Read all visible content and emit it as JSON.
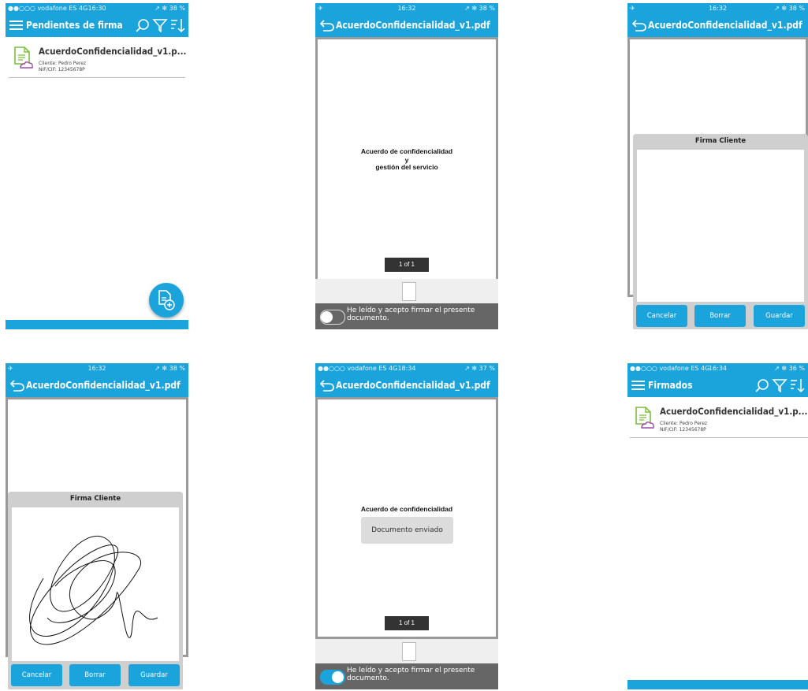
{
  "colors": {
    "accent": "#1ba4dc",
    "overlay": "#666666",
    "panel": "#cfcfcf"
  },
  "screens": [
    {
      "status": {
        "left": "●●○○○ vodafone ES  4G",
        "time": "16:30",
        "right": "↗ ✻ 38 %"
      },
      "title": "Pendientes de firma",
      "item": {
        "name": "AcuerdoConfidencialidad_v1.p...",
        "client": "Cliente: Pedro Perez",
        "nif": "NIF/CIF: 12345678P"
      },
      "icons": [
        "menu-icon",
        "search-icon",
        "filter-icon",
        "sort-icon",
        "add-document-icon"
      ]
    },
    {
      "status": {
        "left": "✈",
        "time": "16:32",
        "right": "↗ ✻ 38 %"
      },
      "title": "AcuerdoConfidencialidad_v1.pdf",
      "pdf_lines": [
        "Acuerdo de confidencialidad",
        "y",
        "gestión del servicio"
      ],
      "pager": "1 of 1",
      "accept": "He leído y acepto firmar el presente documento.",
      "toggle_on": false
    },
    {
      "status": {
        "left": "✈",
        "time": "16:32",
        "right": "↗ ✻ 38 %"
      },
      "title": "AcuerdoConfidencialidad_v1.pdf",
      "sig_title": "Firma Cliente",
      "buttons": [
        "Cancelar",
        "Borrar",
        "Guardar"
      ]
    },
    {
      "status": {
        "left": "✈",
        "time": "16:32",
        "right": "↗ ✻ 38 %"
      },
      "title": "AcuerdoConfidencialidad_v1.pdf",
      "sig_title": "Firma Cliente",
      "buttons": [
        "Cancelar",
        "Borrar",
        "Guardar"
      ]
    },
    {
      "status": {
        "left": "●●○○○ vodafone ES  4G",
        "time": "18:34",
        "right": "↗ ✻ 37 %"
      },
      "title": "AcuerdoConfidencialidad_v1.pdf",
      "pdf_lines": [
        "Acuerdo de confidencialidad"
      ],
      "toast": "Documento enviado",
      "pager": "1 of 1",
      "accept": "He leído y acepto firmar el presente documento.",
      "toggle_on": true
    },
    {
      "status": {
        "left": "●●○○○ vodafone ES  4G",
        "time": "16:34",
        "right": "↗ ✻ 36 %"
      },
      "title": "Firmados",
      "item": {
        "name": "AcuerdoConfidencialidad_v1.p...",
        "client": "Cliente: Pedro Perez",
        "nif": "NIF/CIF: 12345678P"
      }
    }
  ]
}
